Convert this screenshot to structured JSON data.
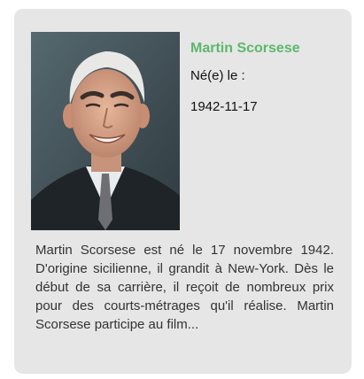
{
  "person": {
    "name": "Martin Scorsese",
    "born_label": "Né(e) le :",
    "born_date": "1942-11-17",
    "photo_icon": "portrait-photo",
    "bio": "Martin Scorsese est né le 17 novembre 1942. D'origine sicilienne, il grandit à New-York. Dès le début de sa carrière, il reçoit de nombreux prix pour des courts-métrages qu'il réalise. Martin Scorsese participe au film..."
  },
  "colors": {
    "card_background": "#e6e6e6",
    "name_accent": "#5cb86a"
  }
}
